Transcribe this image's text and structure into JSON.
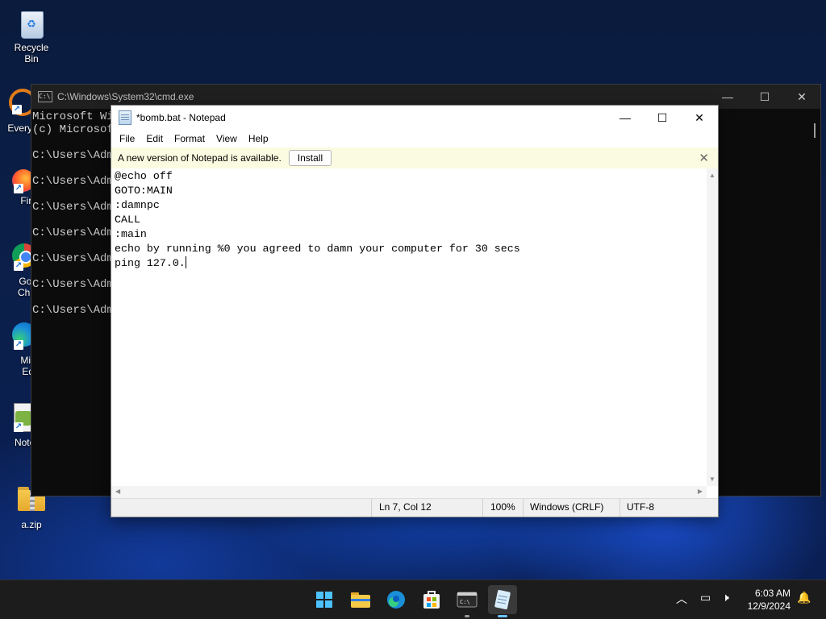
{
  "desktop": {
    "icons": [
      {
        "label": "Recycle Bin"
      },
      {
        "label": "Every"
      },
      {
        "label": "Fire"
      },
      {
        "label": "Goo"
      },
      {
        "label": "Chro"
      },
      {
        "label": "Micr"
      },
      {
        "label": "Ed"
      },
      {
        "label": "Notep"
      },
      {
        "label": "a.zip"
      }
    ]
  },
  "cmd": {
    "title": "C:\\Windows\\System32\\cmd.exe",
    "lines": [
      "Microsoft Wi",
      "(c) Microsoft",
      "C:\\Users\\Adm",
      "C:\\Users\\Adm",
      "C:\\Users\\Adm",
      "C:\\Users\\Adm",
      "C:\\Users\\Adm",
      "C:\\Users\\Adm",
      "C:\\Users\\Adm"
    ]
  },
  "notepad": {
    "title": "*bomb.bat - Notepad",
    "menu": [
      "File",
      "Edit",
      "Format",
      "View",
      "Help"
    ],
    "update_banner": {
      "text": "A new version of Notepad is available.",
      "button": "Install"
    },
    "lines": [
      "@echo off",
      "GOTO:MAIN",
      ":damnpc",
      "CALL",
      ":main",
      "echo by running %0 you agreed to damn your computer for 30 secs",
      "ping 127.0."
    ],
    "status": {
      "position": "Ln 7, Col 12",
      "zoom": "100%",
      "line_ending": "Windows (CRLF)",
      "encoding": "UTF-8"
    }
  },
  "taskbar": {
    "apps": [
      "start-icon",
      "file-explorer-icon",
      "edge-icon",
      "store-icon",
      "terminal-icon",
      "notepad-icon"
    ],
    "time": "6:03 AM",
    "date": "12/9/2024"
  },
  "colors": {
    "accent": "#6cc3ff",
    "banner": "#fbfbe1",
    "cmd_bg": "#0c0c0c"
  }
}
